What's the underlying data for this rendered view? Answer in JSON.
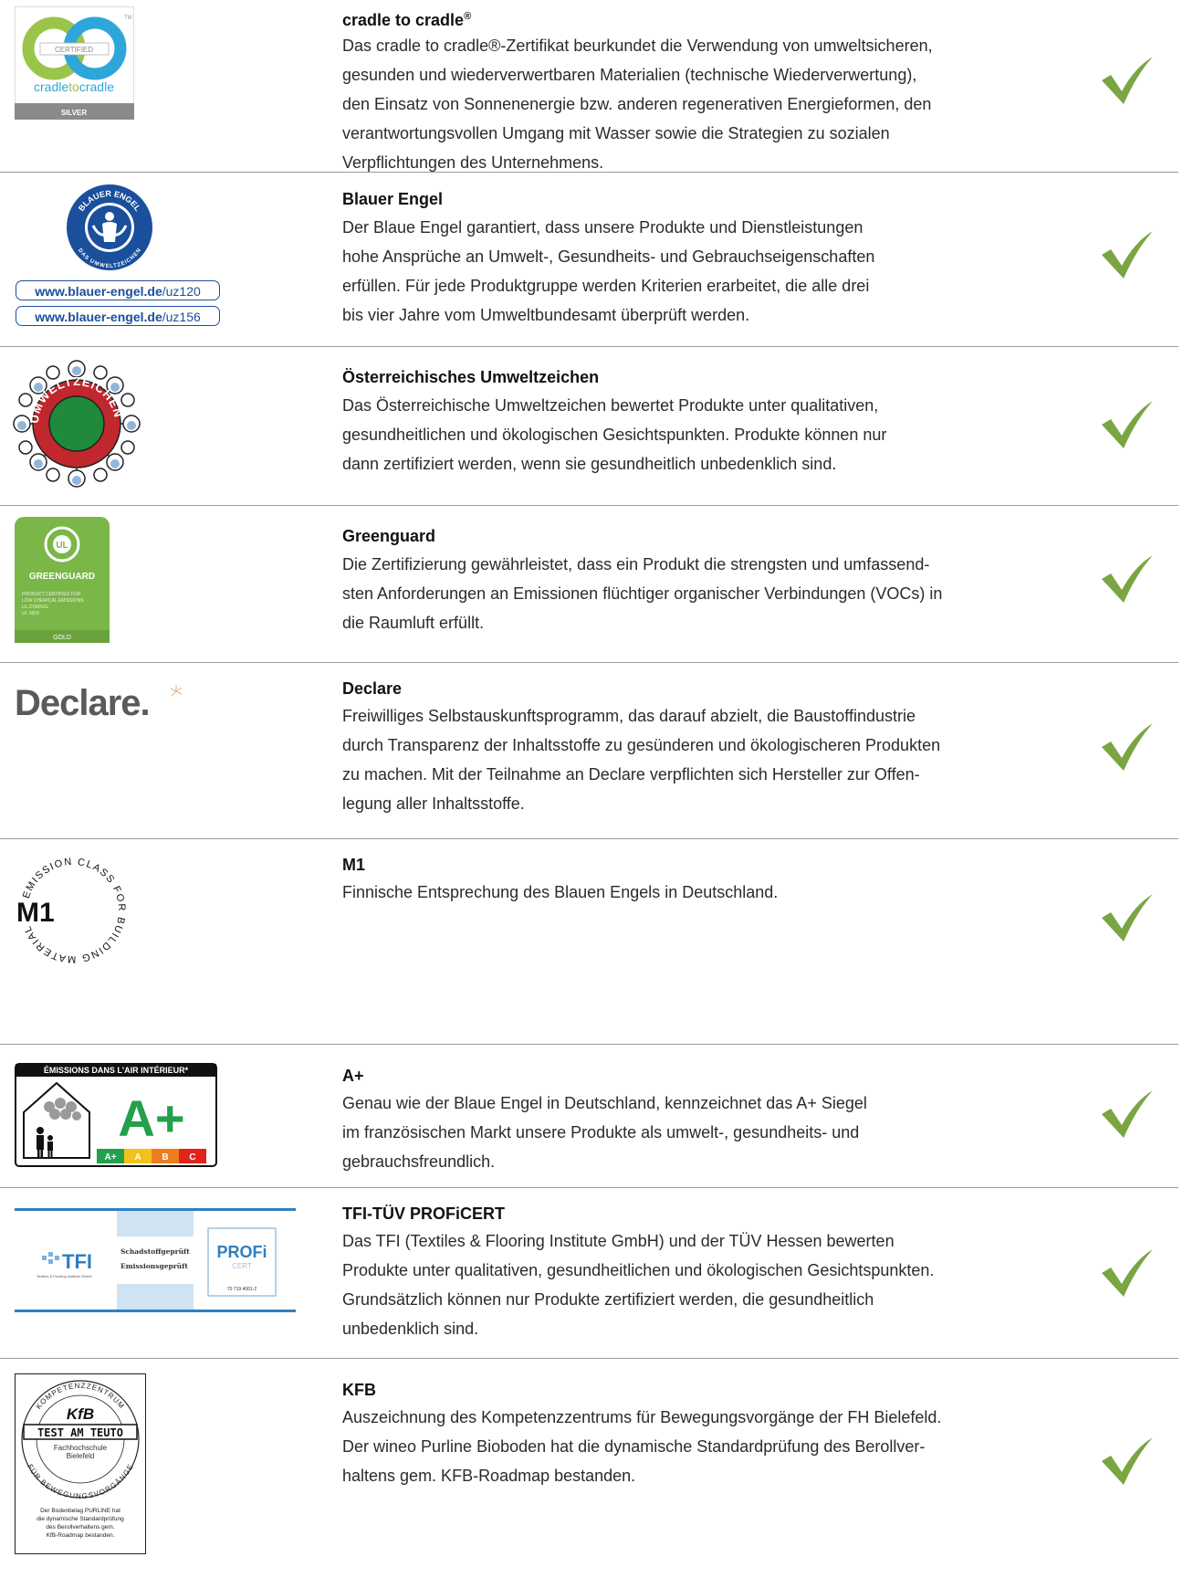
{
  "colors": {
    "check": "#7aa542",
    "divider": "#9a9a9a",
    "engel_blue": "#1a4f9c",
    "greenguard": "#7ab648"
  },
  "items": [
    {
      "id": "cradle",
      "title": "cradle to cradle",
      "title_sup": "®",
      "body": [
        "Das cradle to cradle®-Zertifikat beurkundet die Verwendung von umweltsicheren,",
        "gesunden und wiederverwertbaren Materialien (technische Wiederverwertung),",
        "den Einsatz von Sonnenenergie bzw. anderen regenerativen Energieformen, den",
        "verantwortungsvollen Umgang mit Wasser sowie die Strategien zu sozialen",
        "Verpflichtungen des Unternehmens."
      ],
      "logo": {
        "certified": "CERTIFIED",
        "brand_a": "cradle",
        "brand_b": "to",
        "brand_c": "cradle",
        "level": "SILVER",
        "tm": "TM"
      }
    },
    {
      "id": "blauer-engel",
      "title": "Blauer Engel",
      "body": [
        "Der Blaue Engel garantiert, dass unsere Produkte und Dienstleistungen",
        "hohe Ansprüche an Umwelt-, Gesundheits- und Gebrauchseigenschaften",
        "erfüllen. Für jede Produktgruppe werden Kriterien erarbeitet, die alle drei",
        "bis vier Jahre vom Umweltbundesamt überprüft werden."
      ],
      "logo": {
        "ring_top": "BLAUER ENGEL",
        "ring_bottom": "DAS UMWELTZEICHEN",
        "url_host": "www.blauer-engel.de",
        "url1_path": "/uz120",
        "url2_path": "/uz156"
      }
    },
    {
      "id": "umweltzeichen",
      "title": "Österreichisches Umweltzeichen",
      "body": [
        "Das Österreichische Umweltzeichen bewertet Produkte unter qualitativen,",
        "gesundheitlichen und ökologischen Gesichtspunkten. Produkte können nur",
        "dann zertifiziert werden, wenn sie gesundheitlich unbedenklich sind."
      ],
      "logo": {
        "ring_text": "UMWELTZEICHEN"
      }
    },
    {
      "id": "greenguard",
      "title": "Greenguard",
      "body": [
        "Die Zertifizierung gewährleistet, dass ein Produkt die strengsten und umfassend-",
        "sten Anforderungen an Emissionen flüchtiger organischer Verbindungen (VOCs) in",
        "die Raumluft erfüllt."
      ],
      "logo": {
        "ul": "UL",
        "name": "GREENGUARD",
        "line1": "PRODUCT CERTIFIED FOR",
        "line2": "LOW CHEMICAL EMISSIONS",
        "line3": "UL.COM/GG",
        "line4": "UL 2818",
        "level": "GOLD"
      }
    },
    {
      "id": "declare",
      "title": "Declare",
      "body": [
        "Freiwilliges Selbstauskunftsprogramm, das darauf abzielt, die Baustoffindustrie",
        "durch Transparenz der Inhaltsstoffe zu gesünderen und ökologischeren Produkten",
        "zu machen. Mit der Teilnahme an Declare verpflichten sich Hersteller zur Offen-",
        "legung aller Inhaltsstoffe."
      ],
      "logo": {
        "word": "Declare."
      }
    },
    {
      "id": "m1",
      "title": "M1",
      "body": [
        "Finnische Entsprechung des Blauen Engels in Deutschland."
      ],
      "logo": {
        "mark": "M1",
        "ring_text": "EMISSION CLASS FOR BUILDING MATERIAL"
      }
    },
    {
      "id": "a-plus",
      "title": "A+",
      "body": [
        "Genau wie der Blaue Engel in Deutschland, kennzeichnet das A+ Siegel",
        "im französischen Markt unsere Produkte als umwelt-, gesundheits- und",
        "gebrauchsfreundlich."
      ],
      "logo": {
        "header": "ÉMISSIONS DANS L'AIR INTÉRIEUR*",
        "grade": "A+",
        "scale": [
          "A+",
          "A",
          "B",
          "C"
        ]
      }
    },
    {
      "id": "tfi",
      "title": "TFI-TÜV PROFiCERT",
      "body": [
        "Das TFI (Textiles & Flooring Institute GmbH) und der TÜV Hessen bewerten",
        "Produkte unter qualitativen, gesundheitlichen und ökologischen Gesichtspunkten.",
        "Grundsätzlich können nur Produkte zertifiziert werden, die gesundheitlich",
        "unbedenklich sind."
      ],
      "logo": {
        "tfi": "TFI",
        "tfi_sub": "Textiles & Flooring Institute GmbH",
        "line1": "Schadstoffgeprüft",
        "line2": "Emissionsgeprüft",
        "badge": "PROFi",
        "badge_sub": "CERT",
        "number": "70 719 4061-2"
      }
    },
    {
      "id": "kfb",
      "title": "KFB",
      "body": [
        "Auszeichnung des Kompetenzzentrums für Bewegungsvorgänge der FH Bielefeld.",
        "Der wineo Purline Bioboden hat die dynamische Standardprüfung des Berollver-",
        "haltens gem. KFB-Roadmap bestanden."
      ],
      "logo": {
        "ring_top": "KOMPETENZZENTRUM",
        "ring_bottom": "FÜR BEWEGUNGSVORGÄNGE",
        "mark": "KfB",
        "band": "TEST AM TEUTO",
        "school1": "Fachhochschule",
        "school2": "Bielefeld",
        "caption": [
          "Der Bodenbelag PURLINE hat",
          "die dynamische Standardprüfung",
          "des Berollverhaltens gem.",
          "KfB-Roadmap bestanden."
        ]
      }
    }
  ]
}
